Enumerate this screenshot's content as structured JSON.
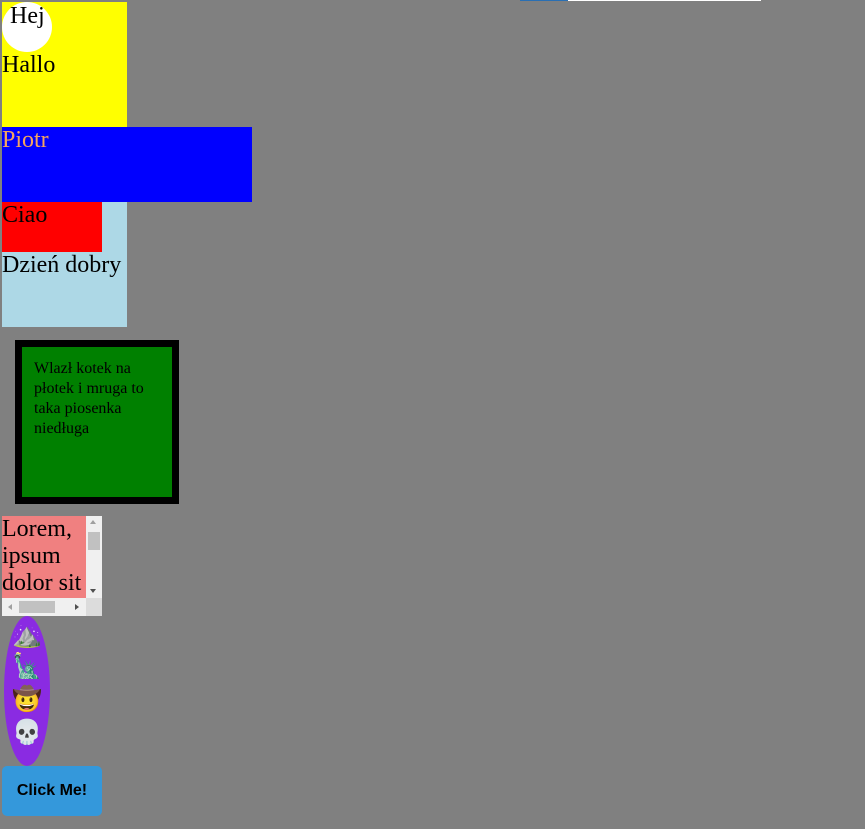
{
  "yellow_box": {
    "circle_text": "Hej",
    "text": "Hallo"
  },
  "blue_bar": {
    "text": "Piotr"
  },
  "lightblue_box": {
    "red_text": "Ciao",
    "text": "Dzień dobry"
  },
  "green_box": {
    "text": "Wlazł kotek na płotek i mruga to taka piosenka niedługa"
  },
  "scroll_box": {
    "text": "Lorem, ipsum dolor sit"
  },
  "icon_column": {
    "icons": [
      {
        "name": "mountain-icon",
        "glyph": "⛰️"
      },
      {
        "name": "statue-of-liberty-icon",
        "glyph": "🗽"
      },
      {
        "name": "cowboy-face-icon",
        "glyph": "🤠"
      },
      {
        "name": "skull-icon",
        "glyph": "💀"
      }
    ]
  },
  "button": {
    "label": "Click Me!"
  },
  "colors": {
    "background": "#808080",
    "yellow": "#ffff00",
    "blue": "#0000ff",
    "lightblue": "#add8e6",
    "red": "#ff0000",
    "green": "#008000",
    "salmon": "#f08080",
    "purple": "#8a2be2",
    "button": "#3498db"
  }
}
